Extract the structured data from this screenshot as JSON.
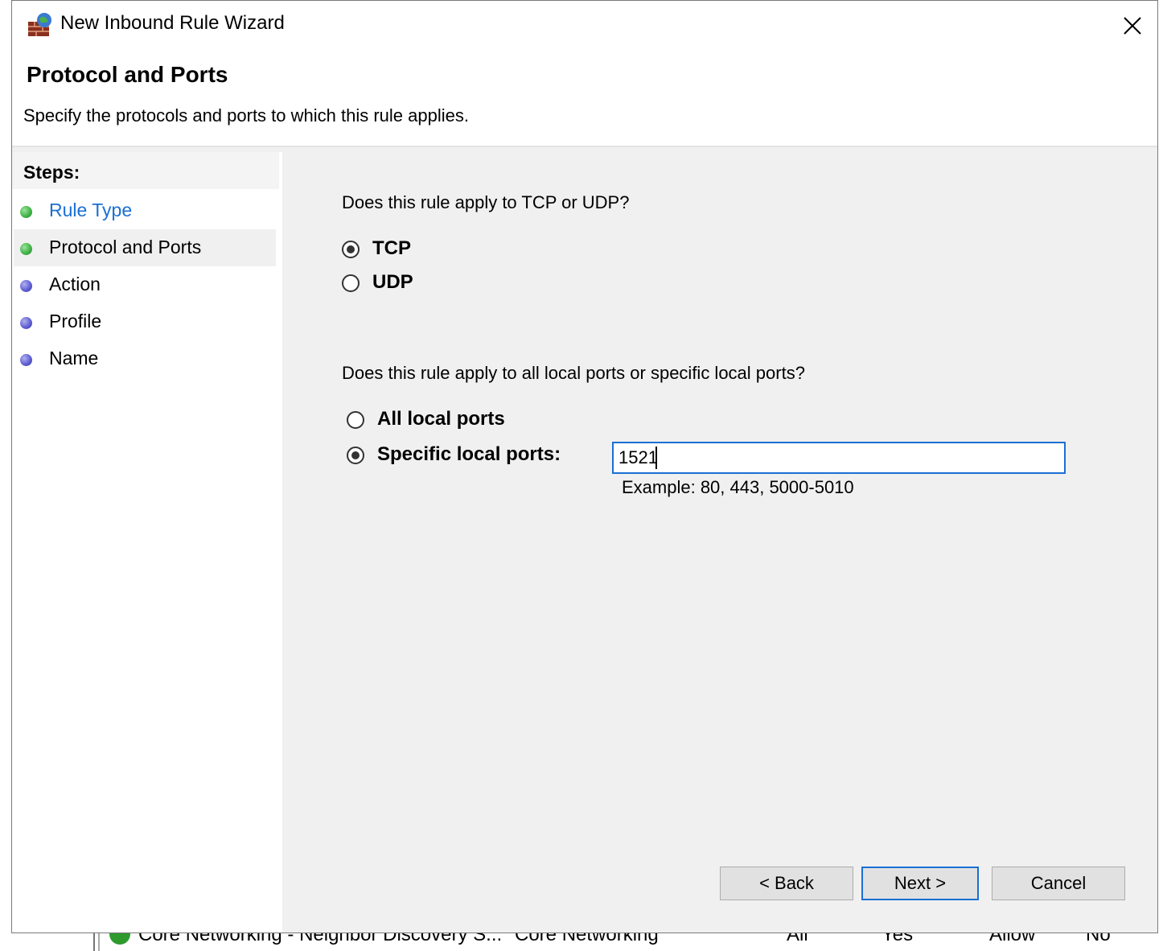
{
  "window": {
    "title": "New Inbound Rule Wizard"
  },
  "header": {
    "title": "Protocol and Ports",
    "subtitle": "Specify the protocols and ports to which this rule applies."
  },
  "sidebar": {
    "title": "Steps:",
    "items": [
      {
        "label": "Rule Type",
        "state": "completed"
      },
      {
        "label": "Protocol and Ports",
        "state": "current"
      },
      {
        "label": "Action",
        "state": "pending"
      },
      {
        "label": "Profile",
        "state": "pending"
      },
      {
        "label": "Name",
        "state": "pending"
      }
    ]
  },
  "protocol": {
    "question": "Does this rule apply to TCP or UDP?",
    "options": [
      {
        "label": "TCP",
        "selected": true
      },
      {
        "label": "UDP",
        "selected": false
      }
    ]
  },
  "ports": {
    "question": "Does this rule apply to all local ports or specific local ports?",
    "options": [
      {
        "label": "All local ports",
        "selected": false
      },
      {
        "label": "Specific local ports:",
        "selected": true
      }
    ],
    "value": "1521",
    "example": "Example: 80, 443, 5000-5010"
  },
  "buttons": {
    "back": "< Back",
    "next": "Next >",
    "cancel": "Cancel"
  },
  "background_row": {
    "name": "Core Networking - Neighbor Discovery S...",
    "group": "Core Networking",
    "profile": "All",
    "enabled": "Yes",
    "action": "Allow",
    "override": "No"
  },
  "colors": {
    "accent": "#1a6fd4",
    "completed_dot": "#3cb043",
    "pending_dot": "#5a5ad0",
    "dialog_bg": "#f0f0f0"
  }
}
